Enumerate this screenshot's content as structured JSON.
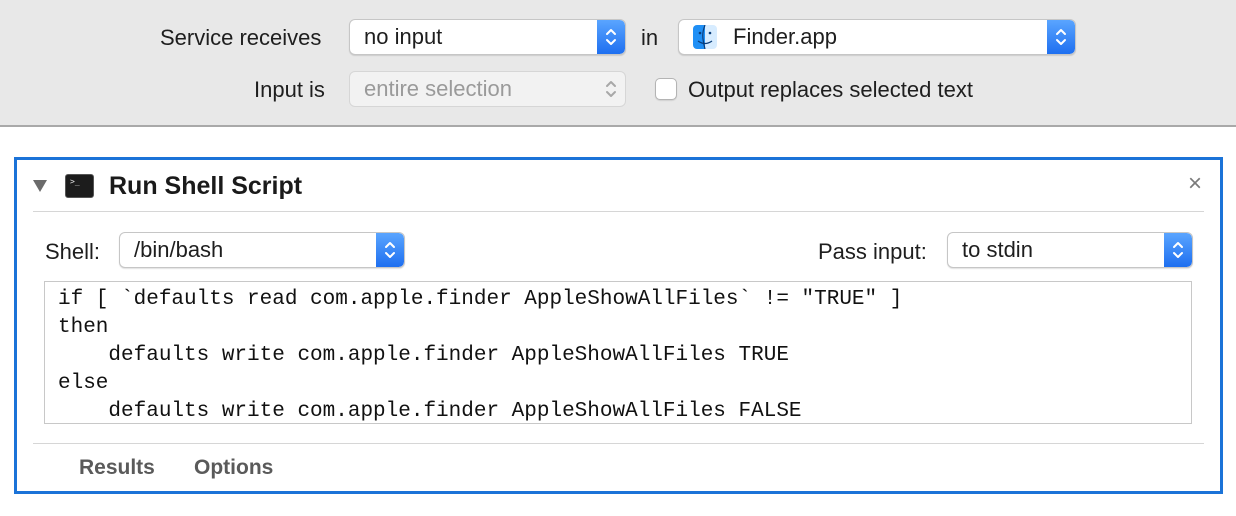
{
  "service": {
    "receives_label": "Service receives",
    "receives_value": "no input",
    "in_label": "in",
    "app_value": "Finder.app",
    "input_is_label": "Input is",
    "input_is_value": "entire selection",
    "output_replaces_label": "Output replaces selected text",
    "output_replaces_checked": false
  },
  "action": {
    "title": "Run Shell Script",
    "icon": "terminal-icon",
    "close_icon": "close-icon",
    "close_glyph": "×",
    "shell_label": "Shell:",
    "shell_value": "/bin/bash",
    "pass_input_label": "Pass input:",
    "pass_input_value": "to stdin",
    "script_lines": [
      "if [ `defaults read com.apple.finder AppleShowAllFiles` != \"TRUE\" ]",
      "then",
      "    defaults write com.apple.finder AppleShowAllFiles TRUE",
      "else",
      "    defaults write com.apple.finder AppleShowAllFiles FALSE"
    ],
    "tabs": [
      "Results",
      "Options"
    ]
  },
  "colors": {
    "accent": "#1b73d8",
    "stepper_blue": "#2f80f5",
    "toolbar_bg": "#e8e8e8"
  }
}
